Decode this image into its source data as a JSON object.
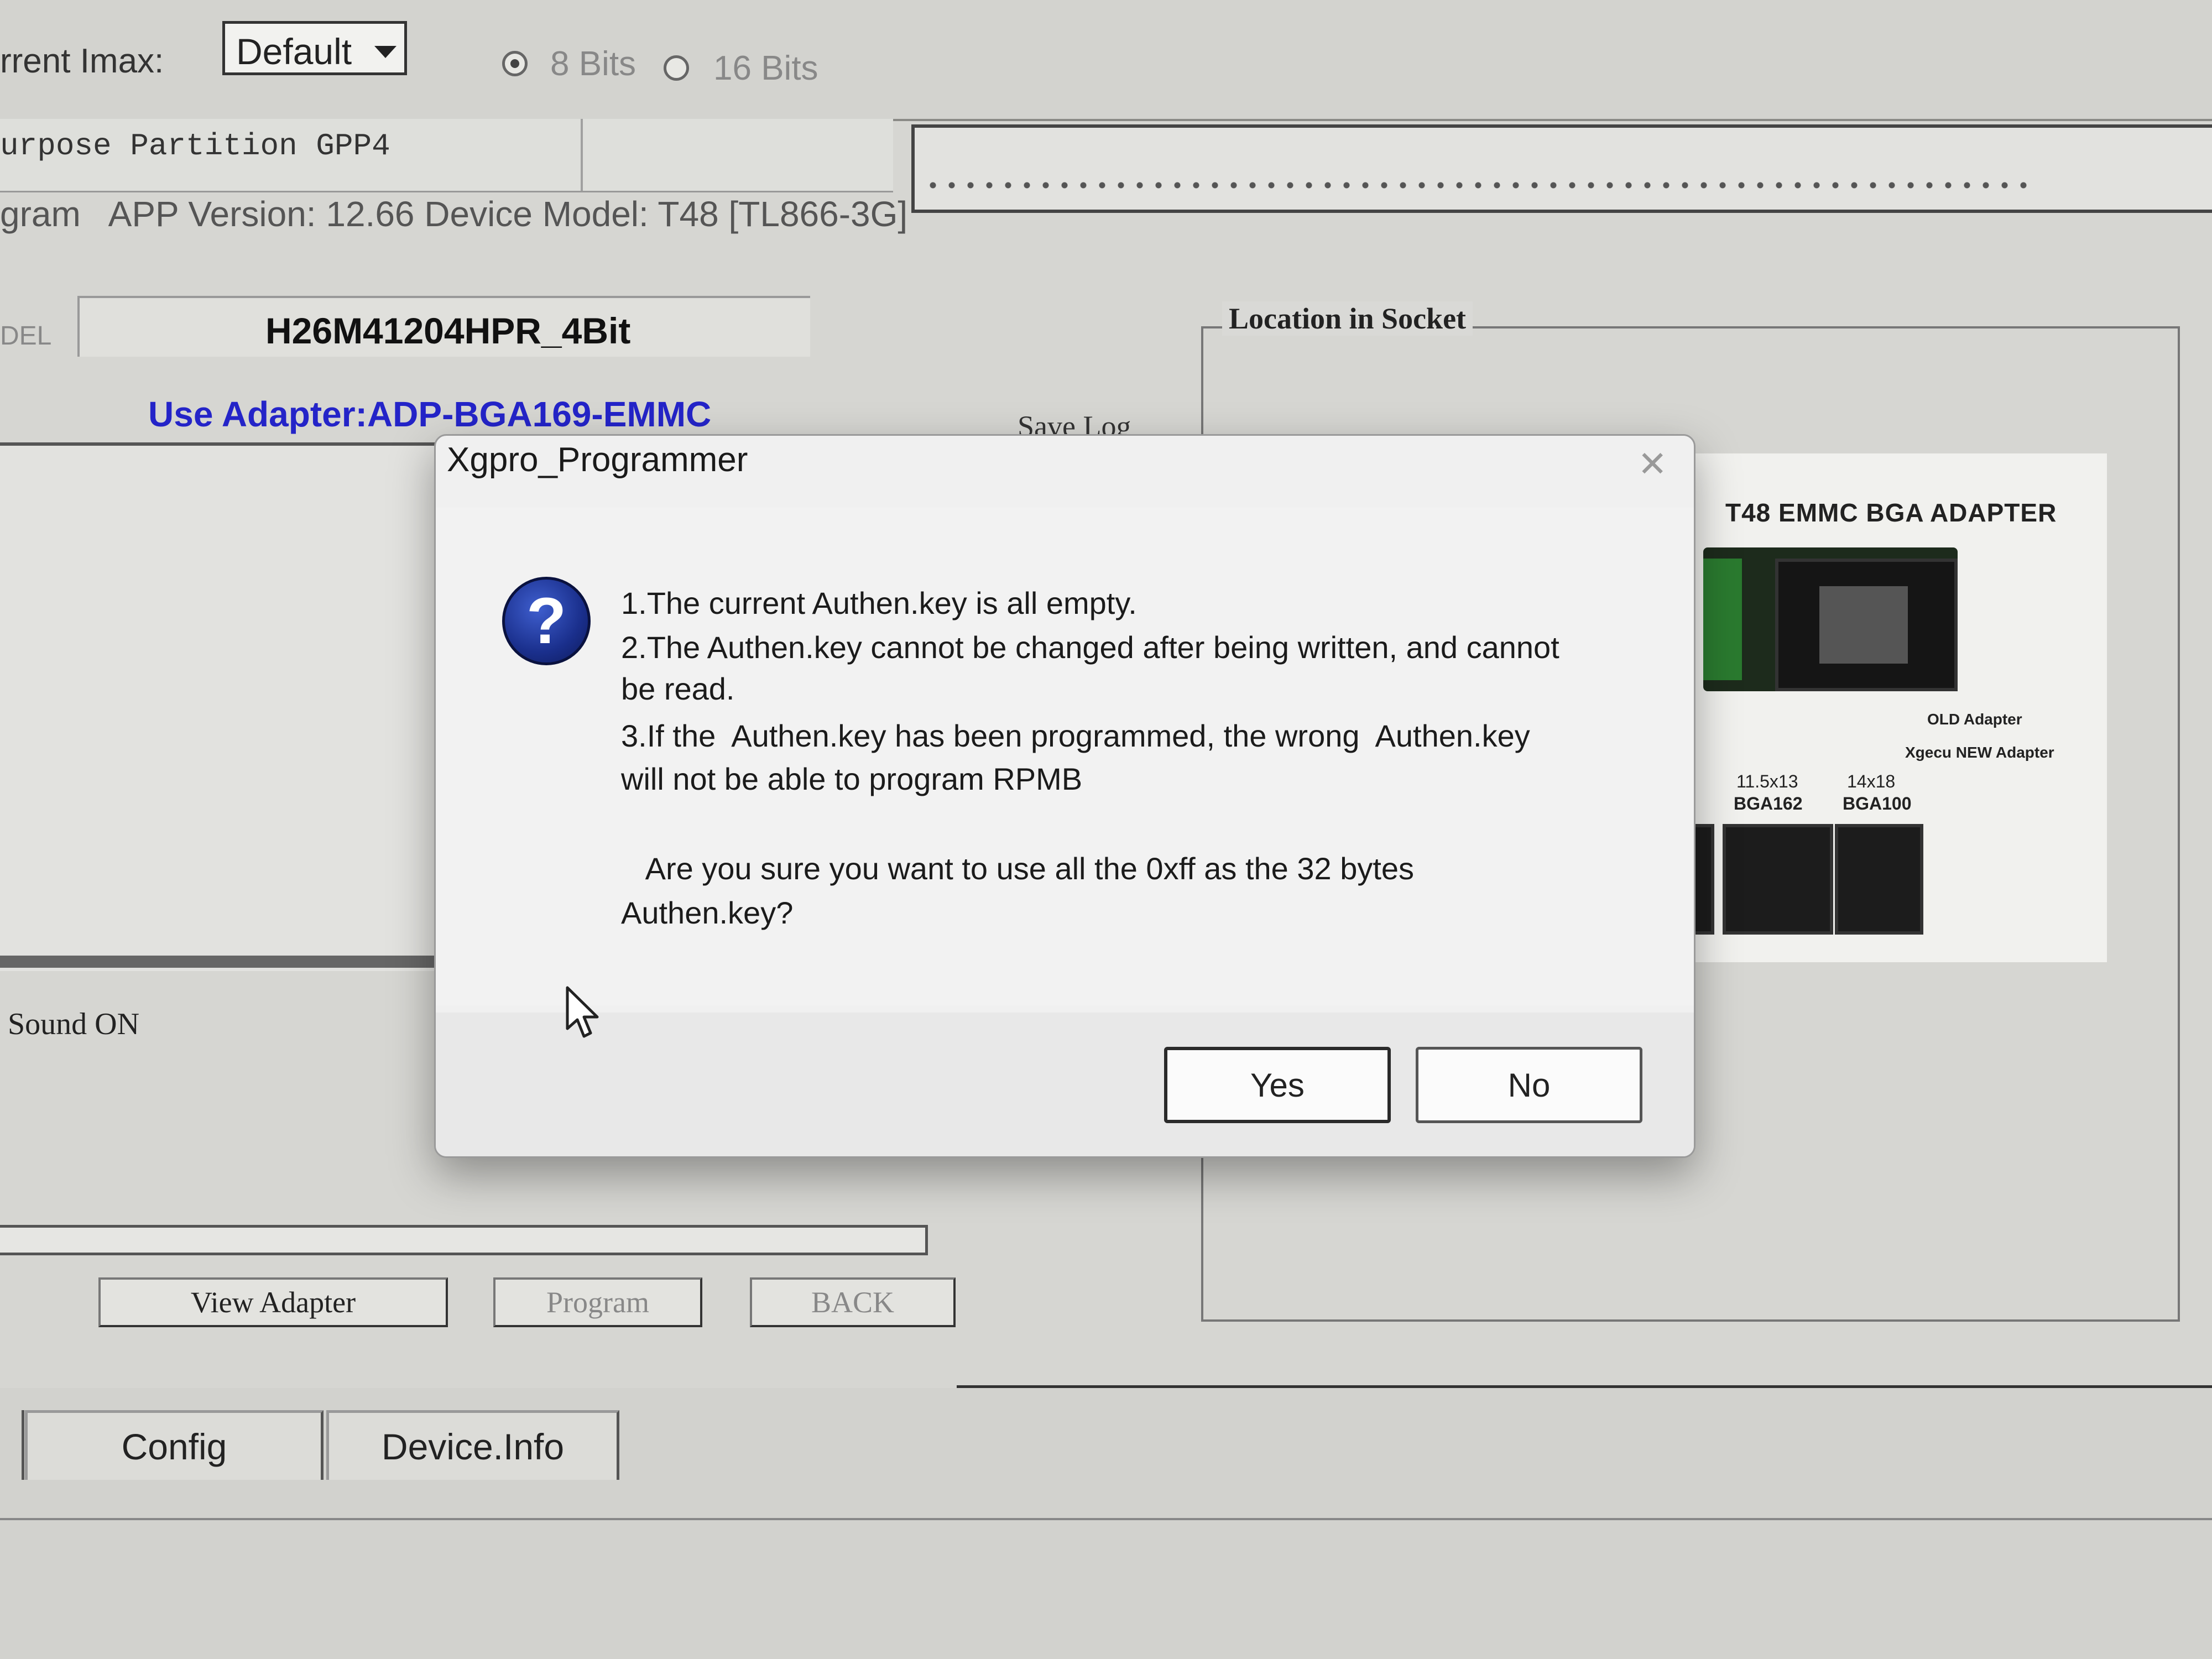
{
  "background": {
    "imax_label": "rrent Imax:",
    "imax_value": "Default",
    "bits_8": "8 Bits",
    "bits_16": "16 Bits",
    "partition": "urpose Partition GPP4",
    "status_line": "gram   APP Version: 12.66 Device Model: T48 [TL866-3G]",
    "model_label": "DEL",
    "model_value": "H26M41204HPR_4Bit",
    "adapter_text": "Use Adapter:ADP-BGA169-EMMC",
    "save_log": "Save Log",
    "sound": "Sound ON",
    "location_legend": "Location in Socket",
    "adapter_image": {
      "title": "T48 EMMC BGA ADAPTER",
      "old": "OLD Adapter",
      "new": "Xgecu NEW Adapter",
      "bga_1_size": "11.5x13",
      "bga_1_name": "BGA162",
      "bga_2_size": "14x18",
      "bga_2_name": "BGA100"
    },
    "buttons": {
      "view_adapter": "View Adapter",
      "program": "Program",
      "back": "BACK"
    },
    "tabs": {
      "config": "Config",
      "device_info": "Device.Info"
    }
  },
  "dialog": {
    "title": "Xgpro_Programmer",
    "close": "✕",
    "icon": "question-icon",
    "lines": [
      "1.The current Authen.key is all empty.",
      "2.The Authen.key cannot be changed after being written, and cannot",
      "be read.",
      "3.If the  Authen.key has been programmed, the wrong  Authen.key",
      "will not be able to program RPMB",
      "   Are you sure you want to use all the 0xff as the 32 bytes",
      "Authen.key?"
    ],
    "yes": "Yes",
    "no": "No"
  },
  "colors": {
    "adapter_text": "#2424c8",
    "icon_blue": "#1a2f8c"
  }
}
